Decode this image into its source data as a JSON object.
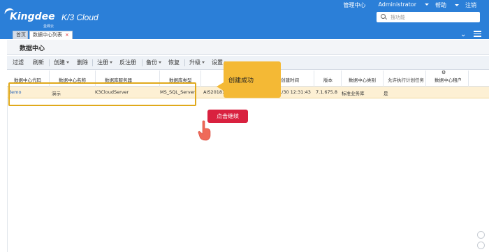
{
  "header": {
    "brand": "Kingdee",
    "brand_sub": "金蝶云",
    "product": "K/3 Cloud",
    "menu": [
      "管理中心",
      "Administrator",
      "帮助",
      "注销"
    ],
    "search_placeholder": "搜功能"
  },
  "tabs": [
    {
      "label": "首页"
    },
    {
      "label": "数据中心列表",
      "close": "×"
    }
  ],
  "page_title": "数据中心",
  "toolbar": [
    "过滤",
    "刷新",
    "创建",
    "删除",
    "注册",
    "反注册",
    "备份",
    "恢复",
    "升级",
    "设置",
    "…"
  ],
  "grid": {
    "columns": [
      "数据中心代码",
      "数据中心名称",
      "数据库服务器",
      "数据库类型",
      "",
      "创建时间",
      "版本",
      "数据中心类别",
      "允许执行计划任务",
      "数据中心租户"
    ],
    "rows": [
      [
        "demo",
        "演示",
        "K3CloudServer",
        "MS_SQL_Server",
        "AIS20181",
        "1/30 12:31:43",
        "7.1.675.8",
        "标准业务库",
        "是",
        ""
      ]
    ]
  },
  "callout": "创建成功",
  "continue_button": "点击继续",
  "colors": {
    "header_bg": "#2b7fd8",
    "highlight": "#e0a91b",
    "callout": "#f4b935",
    "button": "#d9213f",
    "row_selected": "#fdf0d4"
  }
}
